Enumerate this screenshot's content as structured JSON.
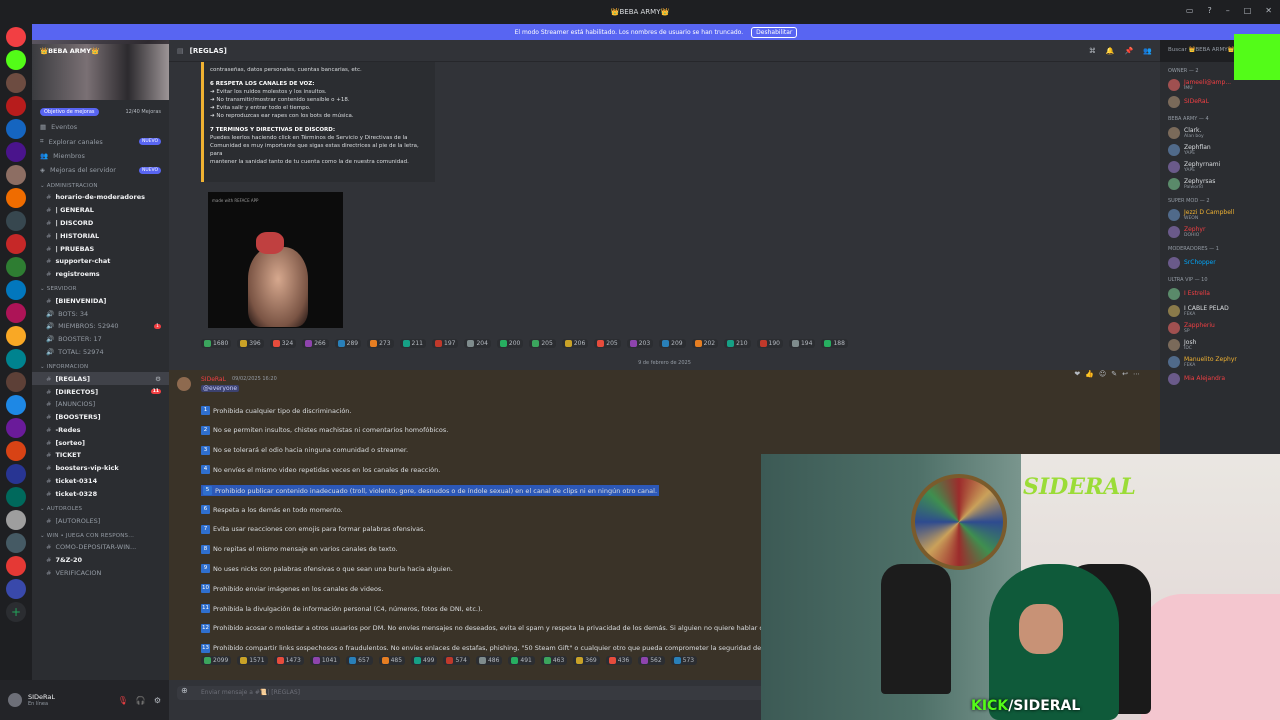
{
  "window": {
    "title": "👑BEBA ARMY👑"
  },
  "streamer_bar": {
    "text": "El modo Streamer está habilitado. Los nombres de usuario se han truncado.",
    "button": "Deshabilitar"
  },
  "guild": {
    "name": "👑BEBA ARMY👑",
    "boost_goal": "Objetivo de mejoras",
    "boost_count": "12/40 Mejoras"
  },
  "nav": [
    {
      "label": "Eventos",
      "icon": "calendar-icon"
    },
    {
      "label": "Explorar canales",
      "icon": "explore-icon",
      "badge": "NUEVO"
    },
    {
      "label": "Miembros",
      "icon": "members-icon"
    },
    {
      "label": "Mejoras del servidor",
      "icon": "boost-icon",
      "badge": "NUEVO"
    }
  ],
  "categories": {
    "administracion": "ADMINISTRACION",
    "servidor": "SERVIDOR",
    "informacion": "INFORMACION",
    "autoroles": "AUTOROLES",
    "win": "WIN • JUEGA CON RESPONS..."
  },
  "channels_admin": [
    "horario-de-moderadores",
    "| GENERAL",
    "| DISCORD",
    "| HISTORIAL",
    "| PRUEBAS",
    "supporter-chat",
    "registroems"
  ],
  "channels_server": [
    "[BIENVENIDA]",
    "BOTS: 34",
    "MIEMBROS: 52940",
    "BOOSTER: 17",
    "TOTAL: 52974"
  ],
  "channels_info": [
    "[REGLAS]",
    "[DIRECTOS]",
    "[ANUNCIOS]",
    "[BOOSTERS]",
    "-Redes",
    "[sorteo]",
    "TICKET",
    "boosters-vip-kick",
    "ticket-0314",
    "ticket-0328"
  ],
  "channels_autoroles": [
    "[AUTOROLES]"
  ],
  "channels_win": [
    "COMO-DEPOSITAR-WIN...",
    "7&Z-20",
    "VERIFICACION"
  ],
  "user": {
    "name": "SIDeRaL",
    "status": "En línea"
  },
  "header": {
    "channel": "[REGLAS]"
  },
  "search": {
    "placeholder": "Buscar 👑BEBA ARMY👑"
  },
  "embed": {
    "line0": "contraseñas, datos personales, cuentas bancarias, etc.",
    "h6": "6   RESPETA LOS CANALES DE VOZ:",
    "v1": "➜ Evitar los ruidos molestos y los insultos.",
    "v2": "➜ No transmitir/mostrar contenido sensible o +18.",
    "v3": "➜ Evita salir y entrar todo el tiempo.",
    "v4": "➜ No reproduzcas ear rapes con los bots de música.",
    "h7": "7   TERMINOS Y DIRECTIVAS DE DISCORD:",
    "t1": "Puedes leerlos haciendo click en Términos de Servicio y Directivas de la",
    "t2": "Comunidad es muy importante que sigas estas directrices al pie de la letra, para",
    "t3": "mantener la sanidad tanto de tu cuenta como la de nuestra comunidad."
  },
  "image_watermark": "made with REFACE APP",
  "reactions1": [
    "1680",
    "396",
    "324",
    "266",
    "289",
    "273",
    "211",
    "197",
    "204",
    "200",
    "205",
    "206",
    "205",
    "203",
    "209",
    "202",
    "210",
    "190",
    "194",
    "188"
  ],
  "date_divider": "9 de febrero de 2025",
  "message": {
    "author": "SIDeRaL",
    "timestamp": "09/02/2025 16:20",
    "mention": "@everyone",
    "rules": [
      {
        "n": "1",
        "text": "Prohibida cualquier tipo de discriminación."
      },
      {
        "n": "2",
        "text": "No se permiten insultos, chistes machistas ni comentarios homofóbicos."
      },
      {
        "n": "3",
        "text": "No se tolerará el odio hacia ninguna comunidad o streamer."
      },
      {
        "n": "4",
        "text": "No envíes el mismo video repetidas veces en los canales de reacción."
      },
      {
        "n": "5",
        "text": "Prohibido publicar contenido inadecuado (troll, violento, gore, desnudos o de índole sexual) en el canal de clips ni en ningún otro canal."
      },
      {
        "n": "6",
        "text": "Respeta a los demás en todo momento."
      },
      {
        "n": "7",
        "text": "Evita usar reacciones con emojis para formar palabras ofensivas."
      },
      {
        "n": "8",
        "text": "No repitas el mismo mensaje en varios canales de texto."
      },
      {
        "n": "9",
        "text": "No uses nicks con palabras ofensivas o que sean una burla hacia alguien."
      },
      {
        "n": "10",
        "text": "Prohibido enviar imágenes en los canales de videos."
      },
      {
        "n": "11",
        "text": "Prohibida la divulgación de información personal (C4, números, fotos de DNI, etc.)."
      },
      {
        "n": "12",
        "text": "Prohibido acosar o molestar a otros usuarios por DM. No envíes mensajes no deseados, evita el spam y respeta la privacidad de los demás. Si alguien no quiere hablar contigo, res"
      },
      {
        "n": "13",
        "text": "Prohibido compartir links sospechosos o fraudulentos. No envíes enlaces de estafas, phishing, \"50 Steam Gift\" o cualquier otro que pueda comprometer la seguridad de los usuar"
      }
    ]
  },
  "reactions2": [
    "2099",
    "1571",
    "1473",
    "1041",
    "657",
    "485",
    "499",
    "574",
    "486",
    "491",
    "463",
    "369",
    "436",
    "562",
    "573"
  ],
  "input": {
    "placeholder": "Enviar mensaje a #📜| [REGLAS]"
  },
  "members": [
    {
      "cat": "OWNER — 2",
      "list": [
        {
          "name": "Jameeli@amp...",
          "tag": "IMU",
          "color": "#f23f43"
        },
        {
          "name": "SIDeRaL",
          "tag": "",
          "color": "#f23f43"
        }
      ]
    },
    {
      "cat": "BEBA ARMY — 4",
      "list": [
        {
          "name": "Clark.",
          "tag": "Alan boy",
          "color": "#dbdee1"
        },
        {
          "name": "Zephflan",
          "tag": "YAPE",
          "color": "#dbdee1"
        },
        {
          "name": "Zephyrnami",
          "tag": "YAPE",
          "color": "#dbdee1"
        },
        {
          "name": "Zephyrsas",
          "tag": "Palworld",
          "color": "#dbdee1"
        }
      ]
    },
    {
      "cat": "SUPER MOD — 2",
      "list": [
        {
          "name": "Jezzi D Campbell",
          "tag": "WEON",
          "color": "#f0b232"
        },
        {
          "name": "Zephyr",
          "tag": "DOHIO",
          "color": "#f23f43"
        }
      ]
    },
    {
      "cat": "MODERADORES — 1",
      "list": [
        {
          "name": "SrChopper",
          "tag": "",
          "color": "#00a8fc"
        }
      ]
    },
    {
      "cat": "ULTRA VIP — 10",
      "list": [
        {
          "name": "I Estrella",
          "tag": "",
          "color": "#f23f43"
        },
        {
          "name": "I CABLE PELAD",
          "tag": "FEKA",
          "color": "#dbdee1"
        },
        {
          "name": "Zappheriu",
          "tag": "SP",
          "color": "#f23f43"
        },
        {
          "name": "Josh",
          "tag": "IDC",
          "color": "#dbdee1"
        },
        {
          "name": "Manuelito Zephyr",
          "tag": "FEKA",
          "color": "#f0b232"
        },
        {
          "name": "Mia Alejandra",
          "tag": "",
          "color": "#f23f43"
        }
      ]
    }
  ],
  "cam": {
    "logo": "SIDERAL",
    "kick_a": "KICK",
    "kick_b": "/SIDERAL"
  },
  "colors": {
    "accent": "#5865f2",
    "kick_green": "#53fc18",
    "highlight": "#2c58b8",
    "danger": "#f23f43"
  }
}
